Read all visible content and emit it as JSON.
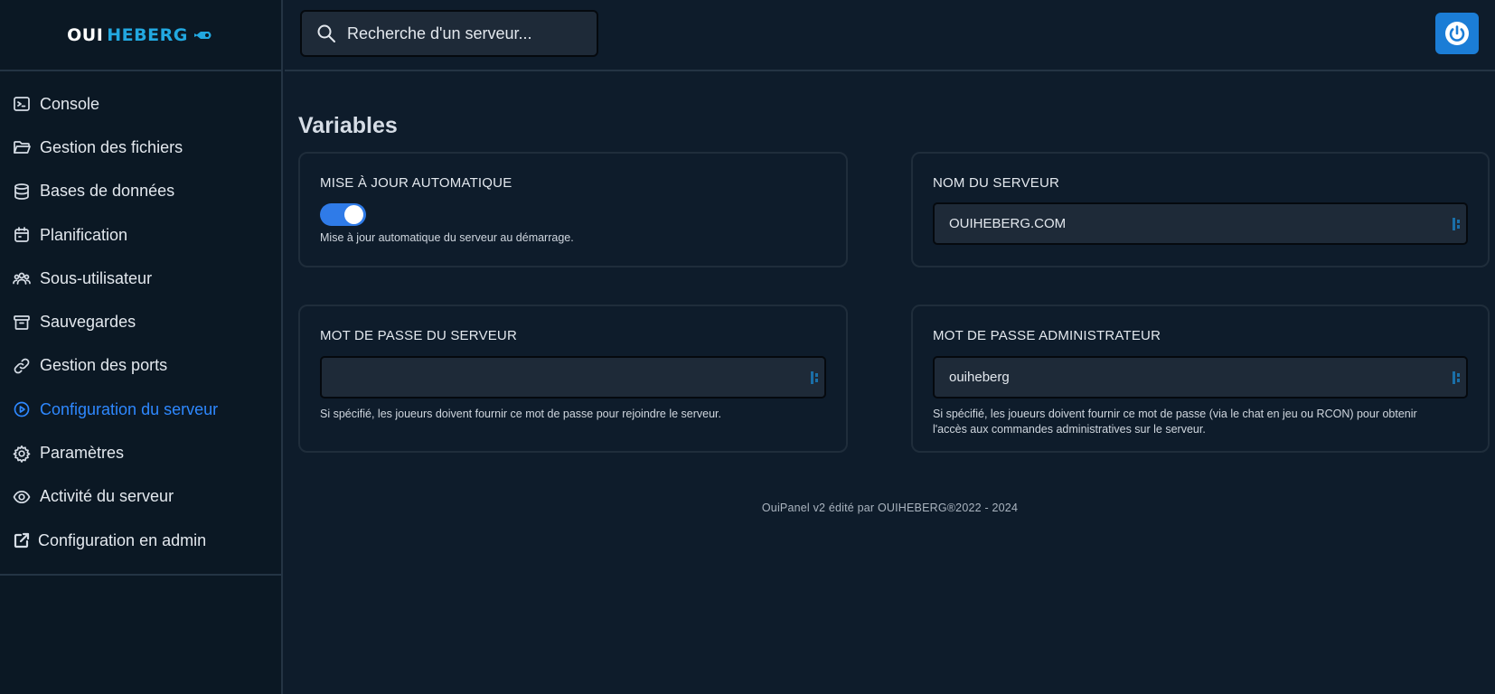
{
  "brand": {
    "part1": "OUI",
    "part2": "HEBERG",
    "accent": "#22a8e0"
  },
  "search": {
    "placeholder": "Recherche d'un serveur..."
  },
  "sidebar": {
    "items": [
      {
        "label": "Console",
        "icon": "terminal-icon"
      },
      {
        "label": "Gestion des fichiers",
        "icon": "folder-icon"
      },
      {
        "label": "Bases de données",
        "icon": "database-icon"
      },
      {
        "label": "Planification",
        "icon": "calendar-icon"
      },
      {
        "label": "Sous-utilisateur",
        "icon": "users-icon"
      },
      {
        "label": "Sauvegardes",
        "icon": "archive-icon"
      },
      {
        "label": "Gestion des ports",
        "icon": "link-icon"
      },
      {
        "label": "Configuration du serveur",
        "icon": "play-circle-icon",
        "active": true
      },
      {
        "label": "Paramètres",
        "icon": "gear-icon"
      },
      {
        "label": "Activité du serveur",
        "icon": "eye-icon"
      },
      {
        "label": "Configuration en admin",
        "icon": "external-link-icon"
      }
    ],
    "active_color": "#2e88ff"
  },
  "main": {
    "title": "Variables",
    "cards": {
      "auto_update": {
        "label": "MISE À JOUR AUTOMATIQUE",
        "enabled": true,
        "description": "Mise à jour automatique du serveur au démarrage."
      },
      "server_name": {
        "label": "NOM DU SERVEUR",
        "value": "OUIHEBERG.COM"
      },
      "server_password": {
        "label": "MOT DE PASSE DU SERVEUR",
        "value": "",
        "description": "Si spécifié, les joueurs doivent fournir ce mot de passe pour rejoindre le serveur."
      },
      "admin_password": {
        "label": "MOT DE PASSE ADMINISTRATEUR",
        "value": "ouiheberg",
        "description_line1": "Si spécifié, les joueurs doivent fournir ce mot de passe (via le chat en jeu ou RCON) pour obtenir",
        "description_line2": "l'accès aux commandes administratives sur le serveur."
      }
    },
    "footer": "OuiPanel v2 édité par OUIHEBERG®2022 - 2024"
  },
  "colors": {
    "background": "#0e1c2b",
    "sidebar": "#0b1824",
    "toggle_on": "#2f7be8",
    "power": "#1b7dd6"
  }
}
